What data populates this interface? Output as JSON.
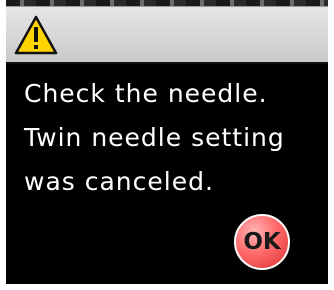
{
  "dialog": {
    "icon": "warning-icon",
    "message_lines": [
      "Check the needle.",
      "Twin needle setting",
      "was canceled."
    ],
    "ok_label": "OK"
  },
  "colors": {
    "header_bg": "#d9d9d9",
    "body_bg": "#000000",
    "text": "#ffffff",
    "warning_fill": "#ffd400",
    "ok_button": "#ff5a5a"
  }
}
